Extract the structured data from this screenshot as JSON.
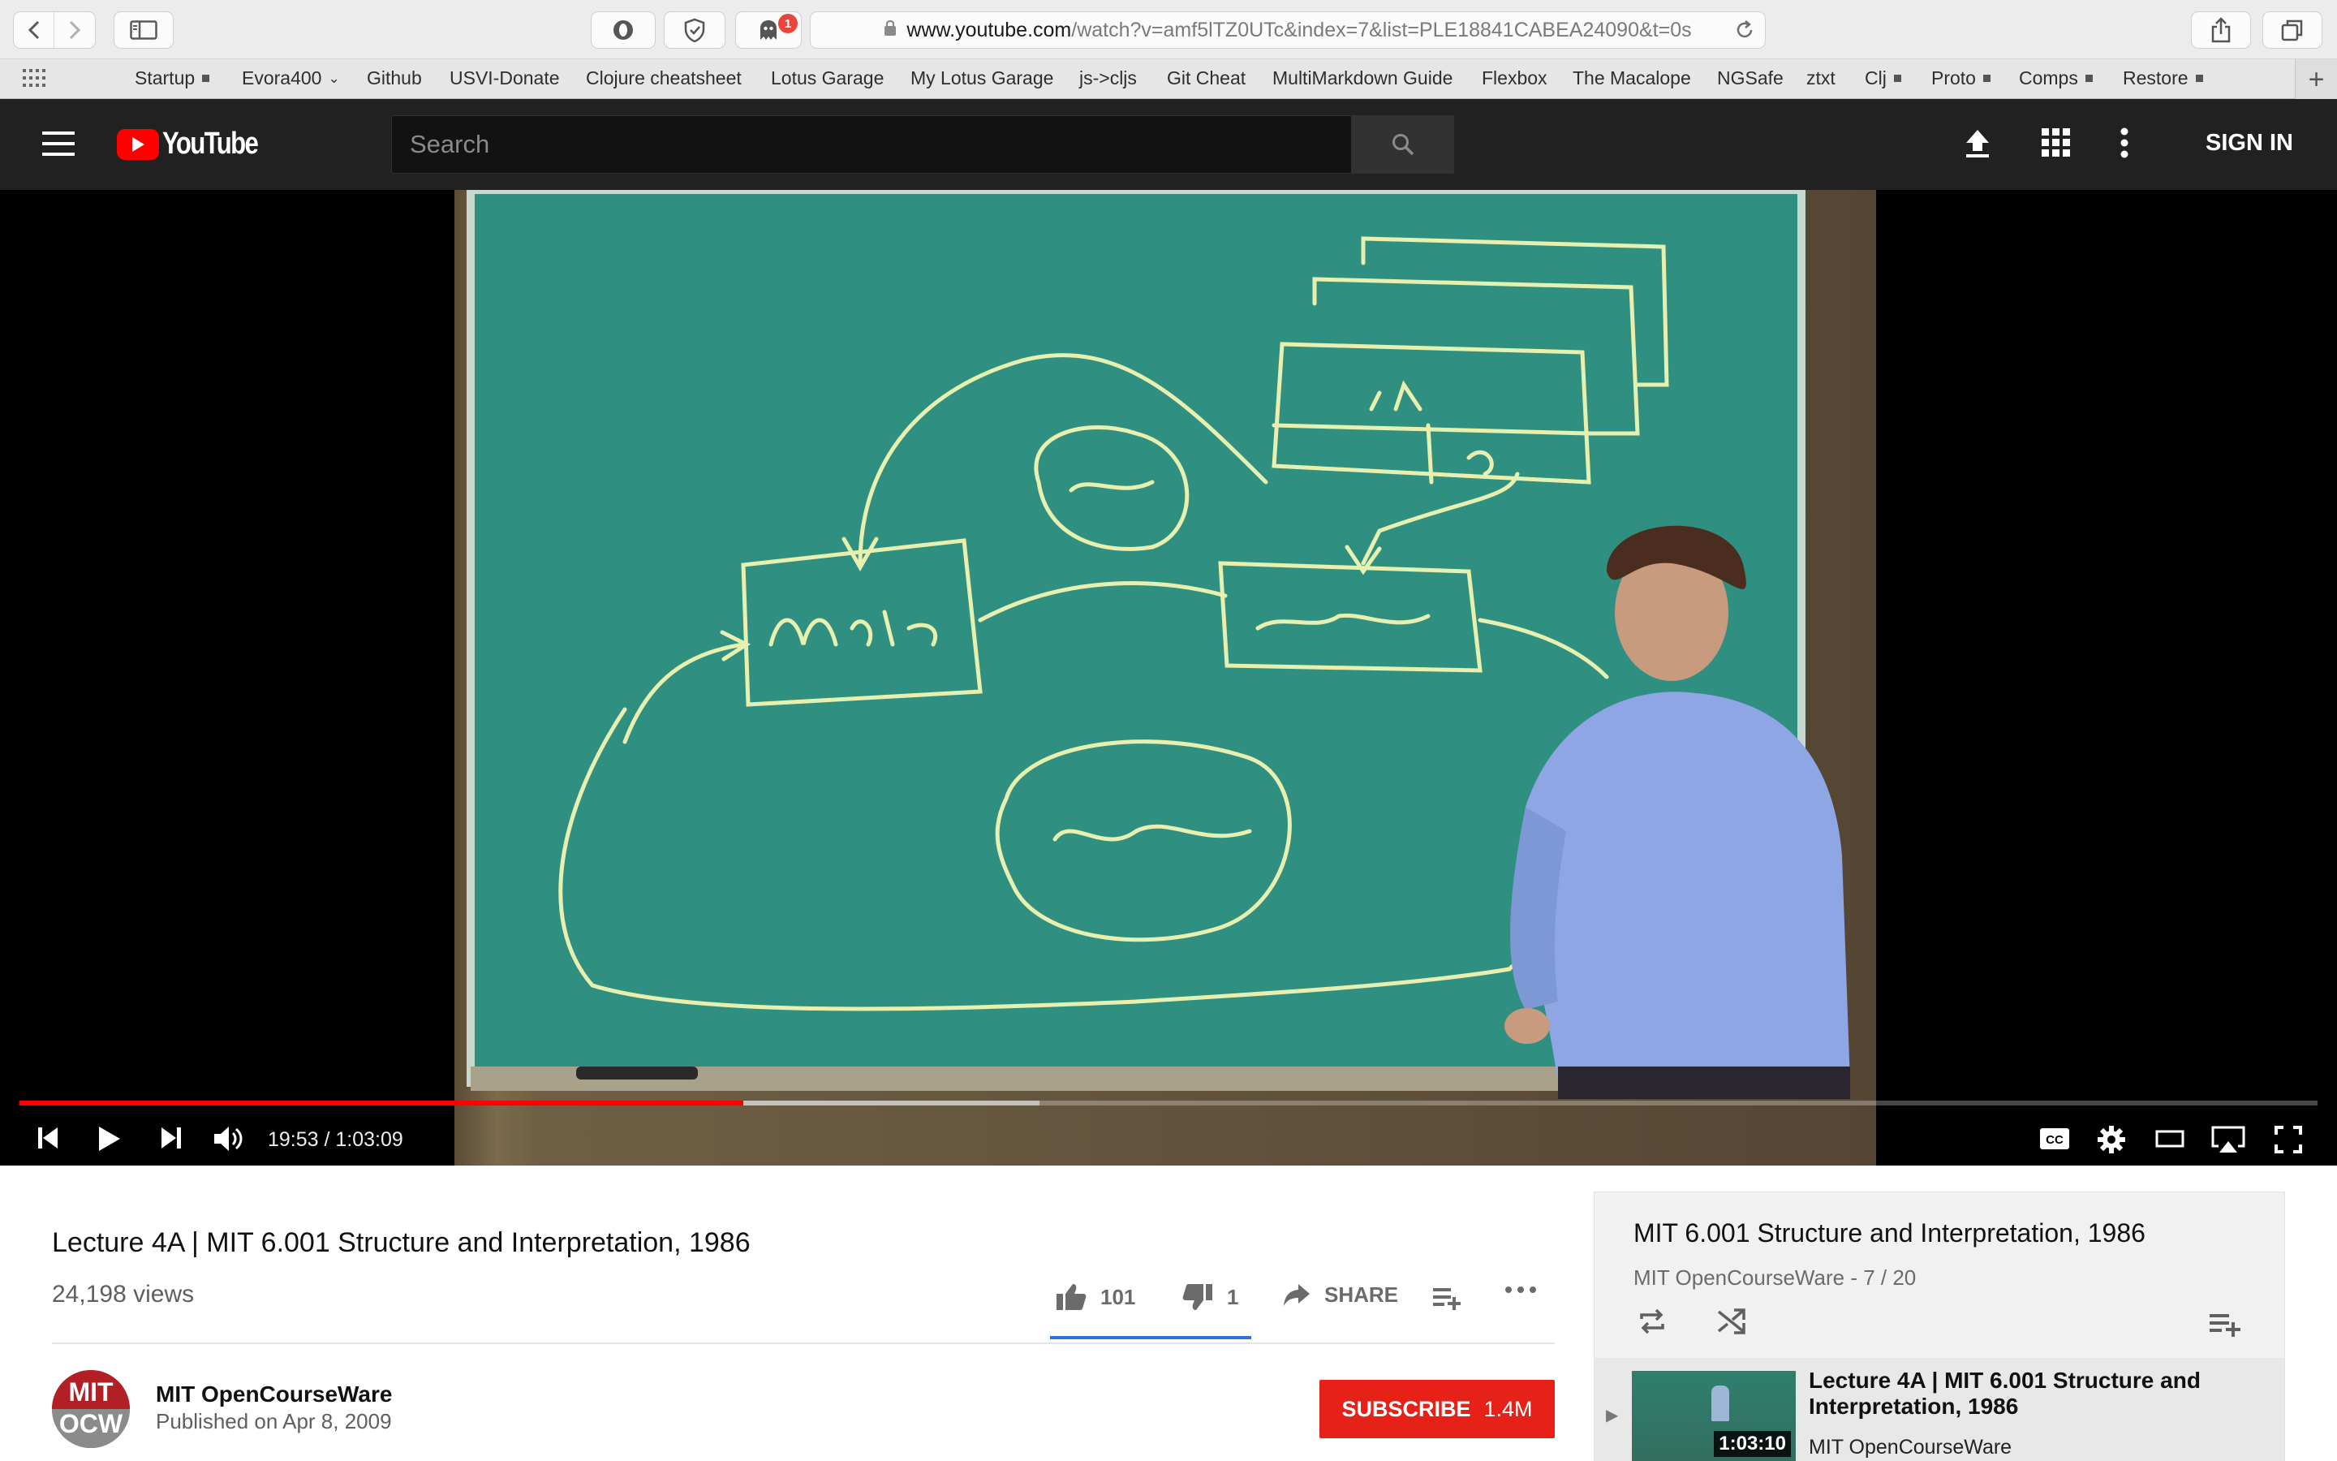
{
  "browser": {
    "url_host": "www.youtube.com",
    "url_path": "/watch?v=amf5lTZ0UTc&index=7&list=PLE18841CABEA24090&t=0s",
    "extension_badge": "1",
    "bookmarks": [
      {
        "label": "Startup",
        "marker": "square"
      },
      {
        "label": "Evora400",
        "marker": "chevron"
      },
      {
        "label": "Github",
        "marker": ""
      },
      {
        "label": "USVI-Donate",
        "marker": ""
      },
      {
        "label": "Clojure cheatsheet",
        "marker": ""
      },
      {
        "label": "Lotus Garage",
        "marker": ""
      },
      {
        "label": "My Lotus Garage",
        "marker": ""
      },
      {
        "label": "js->cljs",
        "marker": ""
      },
      {
        "label": "Git Cheat",
        "marker": ""
      },
      {
        "label": "MultiMarkdown Guide",
        "marker": ""
      },
      {
        "label": "Flexbox",
        "marker": ""
      },
      {
        "label": "The Macalope",
        "marker": ""
      },
      {
        "label": "NGSafe",
        "marker": ""
      },
      {
        "label": "ztxt",
        "marker": ""
      },
      {
        "label": "Clj",
        "marker": "square"
      },
      {
        "label": "Proto",
        "marker": "square"
      },
      {
        "label": "Comps",
        "marker": "square"
      },
      {
        "label": "Restore",
        "marker": "square"
      }
    ]
  },
  "masthead": {
    "logo_text": "YouTube",
    "search_placeholder": "Search",
    "sign_in_label": "SIGN IN",
    "icons": [
      "menu-icon",
      "upload-icon",
      "apps-icon",
      "more-vert-icon",
      "search-icon"
    ]
  },
  "player": {
    "current_time": "19:53",
    "duration": "1:03:09",
    "time_display": "19:53 / 1:03:09",
    "played_fraction": 0.315,
    "buffered_fraction": 0.444
  },
  "video": {
    "title": "Lecture 4A | MIT 6.001 Structure and Interpretation, 1986",
    "views": "24,198 views",
    "likes": "101",
    "dislikes": "1",
    "share_label": "SHARE",
    "channel_name": "MIT OpenCourseWare",
    "published": "Published on Apr 8, 2009",
    "avatar_top": "MIT",
    "avatar_bottom": "OCW",
    "subscribe_label": "SUBSCRIBE",
    "subscriber_count": "1.4M"
  },
  "playlist": {
    "title": "MIT 6.001 Structure and Interpretation, 1986",
    "meta": "MIT OpenCourseWare - 7 / 20",
    "item": {
      "title": "Lecture 4A | MIT 6.001 Structure and Interpretation, 1986",
      "channel": "MIT OpenCourseWare",
      "duration": "1:03:10"
    }
  },
  "colors": {
    "brand_red": "#ff0000",
    "subscribe_red": "#e62117",
    "masthead_bg": "#212121",
    "like_accent": "#2a73d9",
    "chalkboard": "#2f8f80"
  }
}
